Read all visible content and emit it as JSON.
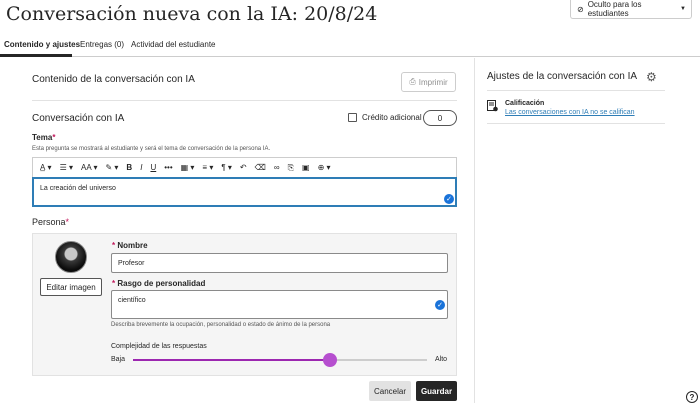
{
  "page": {
    "title": "Conversación nueva con la IA: 20/8/24",
    "visibility_label": "Oculto para los estudiantes"
  },
  "tabs": [
    {
      "label": "Contenido y ajustes",
      "active": true
    },
    {
      "label": "Entregas (0)",
      "active": false
    },
    {
      "label": "Actividad del estudiante",
      "active": false
    }
  ],
  "main": {
    "content_heading": "Contenido de la conversación con IA",
    "print_label": "Imprimir",
    "conversation_heading": "Conversación con IA",
    "extra_credit_label": "Crédito adicional",
    "extra_credit_value": "0",
    "topic_label": "Tema",
    "topic_hint": "Esta pregunta se mostrará al estudiante y será el tema de conversación de la persona IA.",
    "topic_value": "La creación del universo",
    "toolbar": [
      {
        "icon": "text-style-icon",
        "glyph": "A̲ ▾"
      },
      {
        "icon": "paragraph-style-icon",
        "glyph": "☰ ▾"
      },
      {
        "icon": "font-size-icon",
        "glyph": "AA ▾"
      },
      {
        "icon": "highlight-icon",
        "glyph": "✎ ▾"
      },
      {
        "icon": "bold-icon",
        "glyph": "B"
      },
      {
        "icon": "italic-icon",
        "glyph": "I"
      },
      {
        "icon": "underline-icon",
        "glyph": "U"
      },
      {
        "icon": "more-icon",
        "glyph": "•••"
      },
      {
        "icon": "table-icon",
        "glyph": "▦ ▾"
      },
      {
        "icon": "align-icon",
        "glyph": "≡ ▾"
      },
      {
        "icon": "pilcrow-icon",
        "glyph": "¶ ▾"
      },
      {
        "icon": "undo-icon",
        "glyph": "↶"
      },
      {
        "icon": "eraser-icon",
        "glyph": "⌫"
      },
      {
        "icon": "link-icon",
        "glyph": "∞"
      },
      {
        "icon": "attach-icon",
        "glyph": "⎘"
      },
      {
        "icon": "image-icon",
        "glyph": "▣"
      },
      {
        "icon": "insert-icon",
        "glyph": "⊕ ▾"
      }
    ],
    "persona_label": "Persona",
    "edit_image_label": "Editar imagen",
    "name_label": "Nombre",
    "name_value": "Profesor",
    "trait_label": "Rasgo de personalidad",
    "trait_value": "científico",
    "trait_hint": "Describa brevemente la ocupación, personalidad o estado de ánimo de la persona",
    "complexity_label": "Complejidad de las respuestas",
    "complexity_low": "Baja",
    "complexity_high": "Alto",
    "complexity_level": 0.67,
    "cancel_label": "Cancelar",
    "save_label": "Guardar"
  },
  "settings": {
    "title": "Ajustes de la conversación con IA",
    "grading_label": "Calificación",
    "grading_link": "Las conversaciones con IA no se califican"
  },
  "help": "?",
  "colors": {
    "accent_purple": "#9c27b0",
    "accent_blue": "#1a73d9",
    "primary_button": "#262626"
  }
}
